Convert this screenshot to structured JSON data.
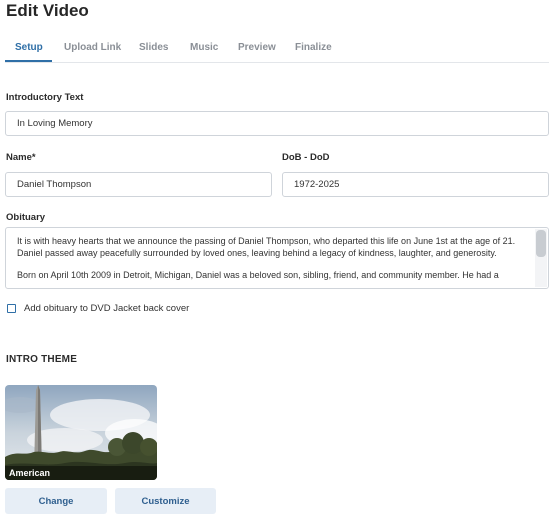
{
  "page": {
    "title": "Edit Video"
  },
  "tabs": [
    {
      "label": "Setup",
      "active": true
    },
    {
      "label": "Upload Link"
    },
    {
      "label": "Slides"
    },
    {
      "label": "Music"
    },
    {
      "label": "Preview"
    },
    {
      "label": "Finalize"
    }
  ],
  "form": {
    "intro": {
      "label": "Introductory Text",
      "value": "In Loving Memory"
    },
    "name": {
      "label": "Name*",
      "value": "Daniel Thompson"
    },
    "dates": {
      "label": "DoB - DoD",
      "value": "1972-2025"
    },
    "obituary": {
      "label": "Obituary",
      "paragraphs": [
        "It is with heavy hearts that we announce the passing of Daniel Thompson, who departed this life on June 1st at the age of 21. Daniel passed away peacefully surrounded by loved ones, leaving behind a legacy of kindness, laughter, and generosity.",
        "Born on April 10th 2009 in Detroit, Michigan, Daniel was a beloved son, sibling, friend, and community member. He had a"
      ]
    },
    "dvd_checkbox": {
      "label": "Add obituary to DVD Jacket back cover",
      "checked": false
    }
  },
  "intro_theme": {
    "section_title": "INTRO THEME",
    "theme_name": "American",
    "change_label": "Change",
    "customize_label": "Customize"
  },
  "colors": {
    "accent": "#2f6fa7",
    "button_bg": "#e7eef6"
  }
}
